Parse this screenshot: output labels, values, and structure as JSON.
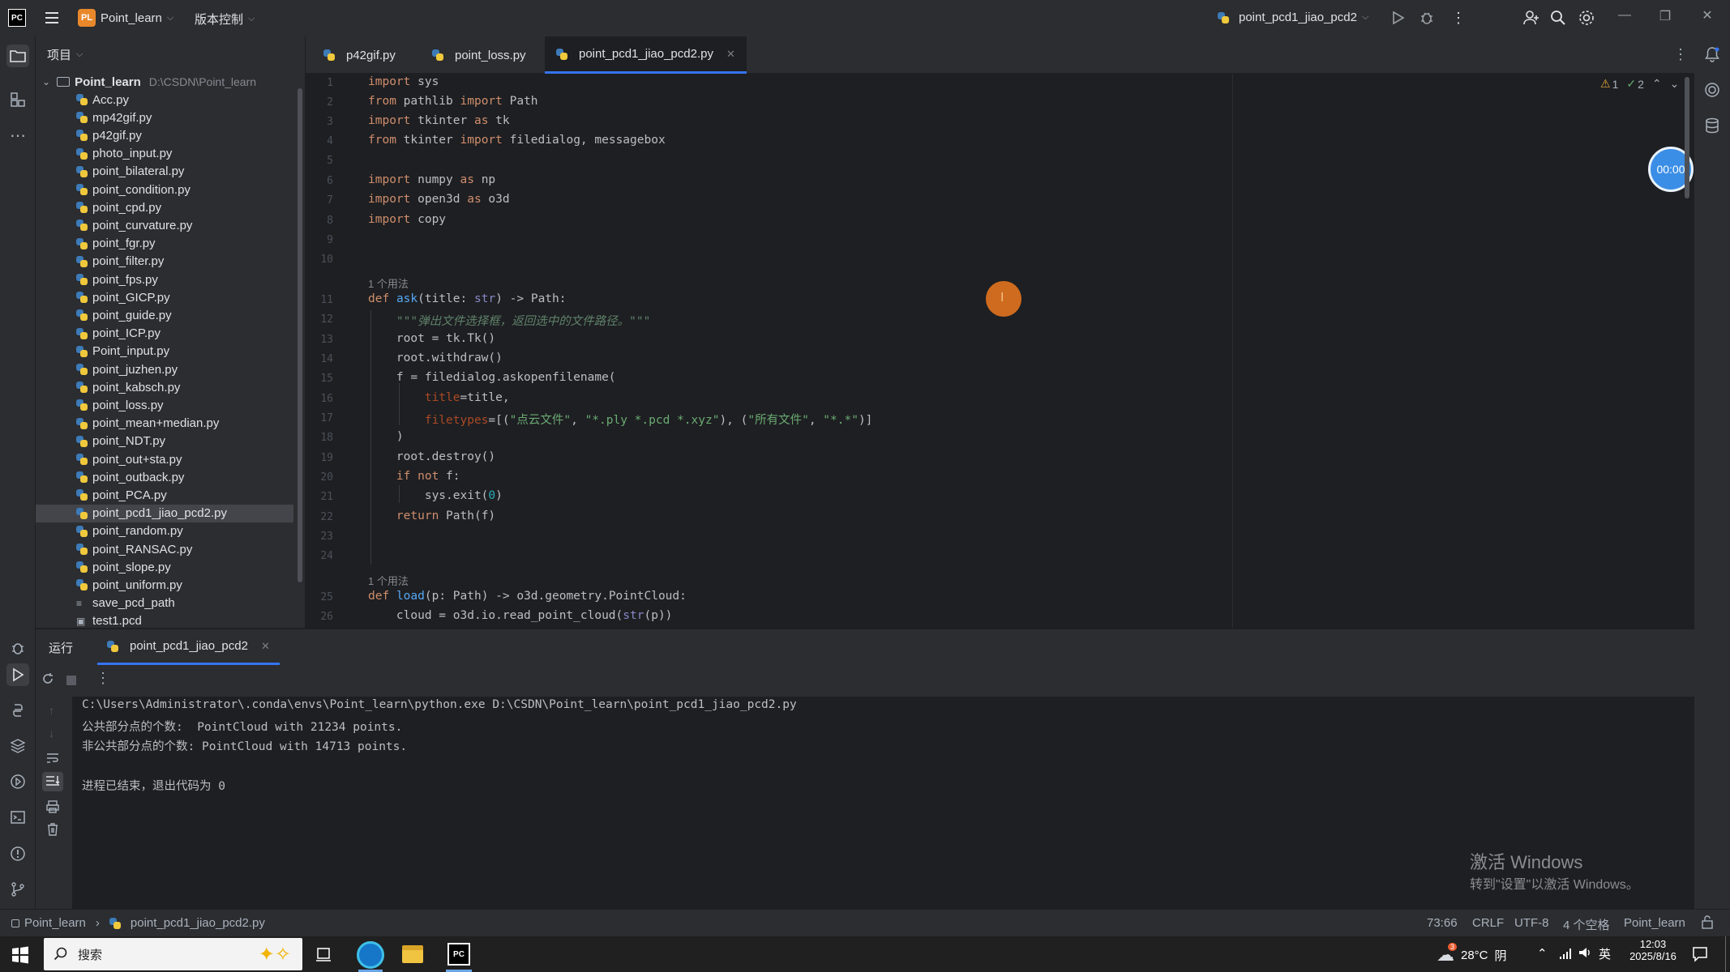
{
  "titlebar": {
    "project_badge": "PL",
    "project_name": "Point_learn",
    "vcs_label": "版本控制",
    "run_config": "point_pcd1_jiao_pcd2"
  },
  "project_panel": {
    "header": "项目",
    "root_name": "Point_learn",
    "root_path": "D:\\CSDN\\Point_learn",
    "files": [
      {
        "name": "Acc.py",
        "type": "py"
      },
      {
        "name": "mp42gif.py",
        "type": "py"
      },
      {
        "name": "p42gif.py",
        "type": "py"
      },
      {
        "name": "photo_input.py",
        "type": "py"
      },
      {
        "name": "point_bilateral.py",
        "type": "py"
      },
      {
        "name": "point_condition.py",
        "type": "py"
      },
      {
        "name": "point_cpd.py",
        "type": "py"
      },
      {
        "name": "point_curvature.py",
        "type": "py"
      },
      {
        "name": "point_fgr.py",
        "type": "py"
      },
      {
        "name": "point_filter.py",
        "type": "py"
      },
      {
        "name": "point_fps.py",
        "type": "py"
      },
      {
        "name": "point_GICP.py",
        "type": "py"
      },
      {
        "name": "point_guide.py",
        "type": "py"
      },
      {
        "name": "point_ICP.py",
        "type": "py"
      },
      {
        "name": "Point_input.py",
        "type": "py"
      },
      {
        "name": "point_juzhen.py",
        "type": "py"
      },
      {
        "name": "point_kabsch.py",
        "type": "py"
      },
      {
        "name": "point_loss.py",
        "type": "py"
      },
      {
        "name": "point_mean+median.py",
        "type": "py"
      },
      {
        "name": "point_NDT.py",
        "type": "py"
      },
      {
        "name": "point_out+sta.py",
        "type": "py"
      },
      {
        "name": "point_outback.py",
        "type": "py"
      },
      {
        "name": "point_PCA.py",
        "type": "py"
      },
      {
        "name": "point_pcd1_jiao_pcd2.py",
        "type": "py",
        "selected": true
      },
      {
        "name": "point_random.py",
        "type": "py"
      },
      {
        "name": "point_RANSAC.py",
        "type": "py"
      },
      {
        "name": "point_slope.py",
        "type": "py"
      },
      {
        "name": "point_uniform.py",
        "type": "py"
      },
      {
        "name": "save_pcd_path",
        "type": "txt"
      },
      {
        "name": "test1.pcd",
        "type": "pcd"
      }
    ]
  },
  "tabs": [
    {
      "label": "p42gif.py",
      "active": false
    },
    {
      "label": "point_loss.py",
      "active": false
    },
    {
      "label": "point_pcd1_jiao_pcd2.py",
      "active": true
    }
  ],
  "editor": {
    "inspection_warnings": "1",
    "inspection_ok": "2",
    "usage_hint": "1 个用法",
    "timer": "00:00",
    "line_numbers": [
      "1",
      "2",
      "3",
      "4",
      "5",
      "6",
      "7",
      "8",
      "9",
      "10",
      "11",
      "12",
      "13",
      "14",
      "15",
      "16",
      "17",
      "18",
      "19",
      "20",
      "21",
      "22",
      "23",
      "24",
      "25",
      "26"
    ],
    "lines": {
      "l1": "import sys",
      "l2": "from pathlib import Path",
      "l3": "import tkinter as tk",
      "l4": "from tkinter import filedialog, messagebox",
      "l6": "import numpy as np",
      "l7": "import open3d as o3d",
      "l8": "import copy",
      "l11": "def ask(title: str) -> Path:",
      "l12": "\"\"\"弹出文件选择框，返回选中的文件路径。\"\"\"",
      "l13": "root = tk.Tk()",
      "l14": "root.withdraw()",
      "l15": "f = filedialog.askopenfilename(",
      "l16": "title=title,",
      "l17": "filetypes=[(\"点云文件\", \"*.ply *.pcd *.xyz\"), (\"所有文件\", \"*.*\")]",
      "l18": ")",
      "l19": "root.destroy()",
      "l20": "if not f:",
      "l21": "sys.exit(0)",
      "l22": "return Path(f)",
      "l25": "def load(p: Path) -> o3d.geometry.PointCloud:",
      "l26": "cloud = o3d.io.read_point_cloud(str(p))"
    }
  },
  "run_panel": {
    "title": "运行",
    "tab_label": "point_pcd1_jiao_pcd2",
    "output": [
      "C:\\Users\\Administrator\\.conda\\envs\\Point_learn\\python.exe D:\\CSDN\\Point_learn\\point_pcd1_jiao_pcd2.py",
      "公共部分点的个数:  PointCloud with 21234 points.",
      "非公共部分点的个数: PointCloud with 14713 points.",
      "",
      "进程已结束，退出代码为 0"
    ]
  },
  "watermark": {
    "line1": "激活 Windows",
    "line2": "转到\"设置\"以激活 Windows。"
  },
  "statusbar": {
    "crumb_project": "Point_learn",
    "crumb_file": "point_pcd1_jiao_pcd2.py",
    "position": "73:66",
    "line_sep": "CRLF",
    "encoding": "UTF-8",
    "indent": "4 个空格",
    "interpreter": "Point_learn"
  },
  "taskbar": {
    "search_placeholder": "搜索",
    "weather_temp": "28°C",
    "weather_desc": "阴",
    "weather_badge": "3",
    "ime": "英",
    "time": "12:03",
    "date": "2025/8/16"
  }
}
